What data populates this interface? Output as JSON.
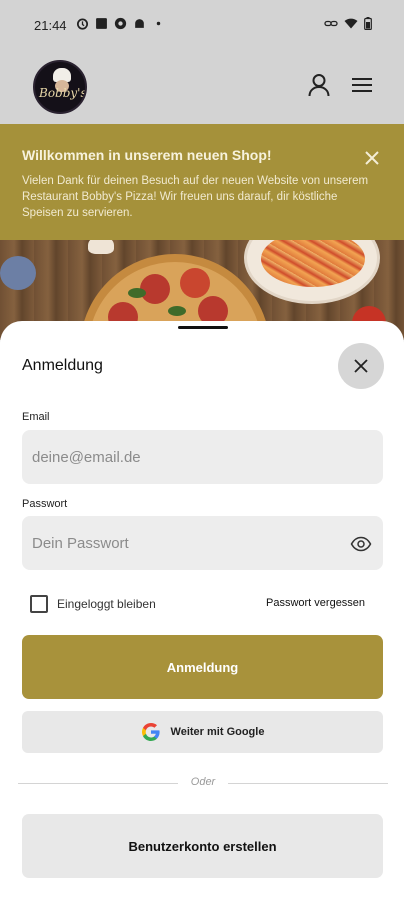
{
  "status_bar": {
    "time": "21:44",
    "icons_left": [
      "alarm-icon",
      "square-app-icon",
      "circle-app-icon",
      "android-icon",
      "dot-icon"
    ],
    "icons_right": [
      "link-icon",
      "wifi-icon",
      "battery-icon"
    ]
  },
  "header": {
    "logo_text": "Bobby's",
    "icons": [
      "user-icon",
      "hamburger-menu-icon"
    ]
  },
  "banner": {
    "title": "Willkommen in unserem neuen Shop!",
    "text": "Vielen Dank für deinen Besuch auf der neuen Website von unserem Restaurant Bobby's Pizza! Wir freuen uns darauf, dir köstliche Speisen zu servieren.",
    "background": "#a5913a"
  },
  "login": {
    "title": "Anmeldung",
    "email_label": "Email",
    "email_placeholder": "deine@email.de",
    "password_label": "Passwort",
    "password_placeholder": "Dein Passwort",
    "remember_label": "Eingeloggt bleiben",
    "remember_checked": false,
    "forgot_label": "Passwort vergessen",
    "submit_label": "Anmeldung",
    "google_label": "Weiter mit Google",
    "divider_text": "Oder",
    "create_account_label": "Benutzerkonto erstellen",
    "accent_color": "#a8923b"
  }
}
